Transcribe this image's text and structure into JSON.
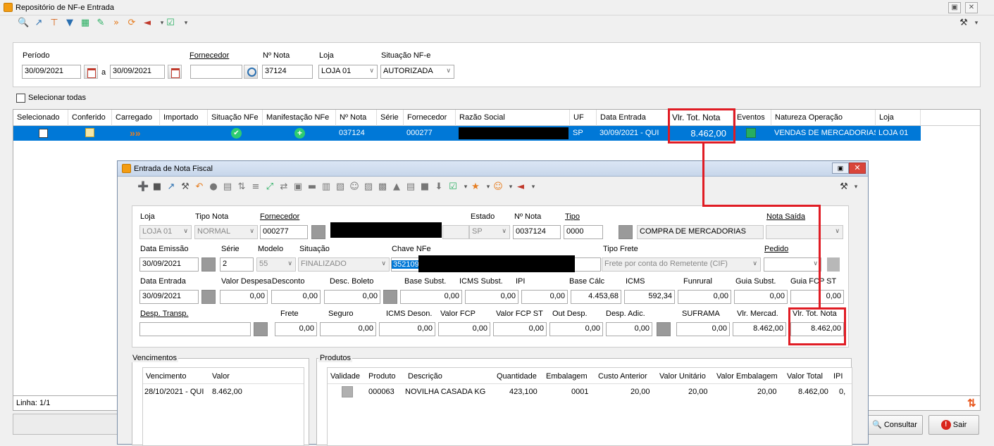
{
  "outer": {
    "title": "Repositório de NF-e Entrada",
    "filters": {
      "periodo_label": "Período",
      "date_from": "30/09/2021",
      "a_label": "a",
      "date_to": "30/09/2021",
      "fornecedor_label": "Fornecedor",
      "fornecedor_value": "",
      "nota_label": "Nº Nota",
      "nota_value": "37124",
      "loja_label": "Loja",
      "loja_value": "LOJA 01",
      "situacao_label": "Situação NF-e",
      "situacao_value": "AUTORIZADA"
    },
    "select_all_label": "Selecionar todas",
    "grid": {
      "columns": [
        "Selecionado",
        "Conferido",
        "Carregado",
        "Importado",
        "Situação NFe",
        "Manifestação NFe",
        "Nº Nota",
        "Série",
        "Fornecedor",
        "Razão Social",
        "UF",
        "Data Entrada",
        "Vlr. Tot. Nota",
        "Eventos",
        "Natureza Operação",
        "Loja"
      ],
      "row": {
        "nota": "037124",
        "serie": "",
        "fornecedor": "000277",
        "uf": "SP",
        "data_entrada": "30/09/2021 - QUI",
        "vlr_tot_nota": "8.462,00",
        "natureza": "VENDAS DE MERCADORIAS",
        "loja": "LOJA 01"
      }
    },
    "status_line": "Linha: 1/1",
    "consultar_label": "Consultar",
    "sair_label": "Sair"
  },
  "inner": {
    "title": "Entrada de Nota Fiscal",
    "row1": {
      "loja_label": "Loja",
      "loja_value": "LOJA 01",
      "tipo_nota_label": "Tipo Nota",
      "tipo_nota_value": "NORMAL",
      "fornecedor_label": "Fornecedor",
      "fornecedor_value": "000277",
      "estado_label": "Estado",
      "estado_value": "SP",
      "nota_label": "Nº Nota",
      "nota_value": "0037124",
      "tipo_label": "Tipo",
      "tipo_value": "0000",
      "tipo_desc": "COMPRA DE MERCADORIAS",
      "nota_saida_label": "Nota Saída"
    },
    "row2": {
      "data_emissao_label": "Data Emissão",
      "data_emissao_value": "30/09/2021",
      "serie_label": "Série",
      "serie_value": "2",
      "modelo_label": "Modelo",
      "modelo_value": "55",
      "situacao_label": "Situação",
      "situacao_value": "FINALIZADO",
      "chave_label": "Chave NFe",
      "chave_value": "352109",
      "tipo_frete_label": "Tipo Frete",
      "tipo_frete_value": "Frete por conta do Remetente (CIF)",
      "pedido_label": "Pedido"
    },
    "row3": {
      "data_entrada_label": "Data Entrada",
      "data_entrada_value": "30/09/2021",
      "valor_despesa_label": "Valor Despesa",
      "valor_despesa_value": "0,00",
      "desconto_label": "Desconto",
      "desconto_value": "0,00",
      "desc_boleto_label": "Desc. Boleto",
      "desc_boleto_value": "0,00",
      "base_subst_label": "Base Subst.",
      "base_subst_value": "0,00",
      "icms_subst_label": "ICMS Subst.",
      "icms_subst_value": "0,00",
      "ipi_label": "IPI",
      "ipi_value": "0,00",
      "base_calc_label": "Base Cálc",
      "base_calc_value": "4.453,68",
      "icms_label": "ICMS",
      "icms_value": "592,34",
      "funrural_label": "Funrural",
      "funrural_value": "0,00",
      "guia_subst_label": "Guia Subst.",
      "guia_subst_value": "0,00",
      "guia_fcp_label": "Guia FCP ST",
      "guia_fcp_value": "0,00"
    },
    "row4": {
      "desp_transp_label": "Desp. Transp.",
      "frete_label": "Frete",
      "frete_value": "0,00",
      "seguro_label": "Seguro",
      "seguro_value": "0,00",
      "icms_deson_label": "ICMS Deson.",
      "icms_deson_value": "0,00",
      "valor_fcp_label": "Valor FCP",
      "valor_fcp_value": "0,00",
      "valor_fcp_st_label": "Valor FCP ST",
      "valor_fcp_st_value": "0,00",
      "out_desp_label": "Out Desp.",
      "out_desp_value": "0,00",
      "desp_adic_label": "Desp. Adic.",
      "desp_adic_value": "0,00",
      "suframa_label": "SUFRAMA",
      "suframa_value": "0,00",
      "vlr_mercad_label": "Vlr. Mercad.",
      "vlr_mercad_value": "8.462,00",
      "vlr_tot_label": "Vlr. Tot. Nota",
      "vlr_tot_value": "8.462,00"
    },
    "vencimentos": {
      "title": "Vencimentos",
      "columns": [
        "Vencimento",
        "Valor"
      ],
      "row": [
        "28/10/2021 - QUI",
        "8.462,00"
      ]
    },
    "produtos": {
      "title": "Produtos",
      "columns": [
        "Validade",
        "Produto",
        "Descrição",
        "Quantidade",
        "Embalagem",
        "Custo Anterior",
        "Valor Unitário",
        "Valor Embalagem",
        "Valor Total",
        "IPI"
      ],
      "row": [
        "",
        "000063",
        "NOVILHA CASADA KG",
        "423,100",
        "0001",
        "20,00",
        "20,00",
        "20,00",
        "8.462,00",
        "0,"
      ]
    }
  }
}
